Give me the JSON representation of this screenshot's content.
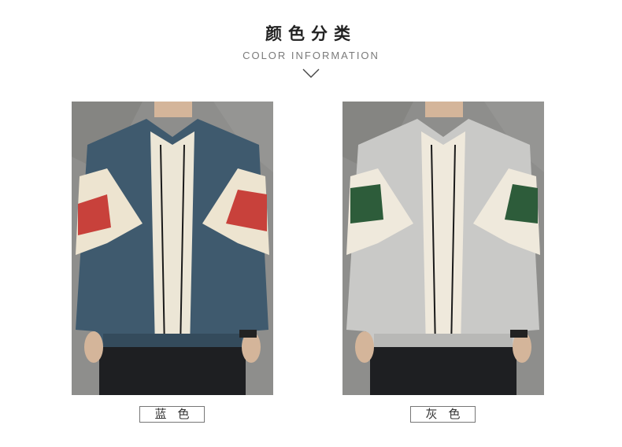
{
  "header": {
    "title": "颜色分类",
    "subtitle": "COLOR INFORMATION"
  },
  "products": [
    {
      "label": "蓝色",
      "jacket_color": "#3f5a6e",
      "stripe_color": "#c8413b",
      "panel_color": "#ede4d0"
    },
    {
      "label": "灰色",
      "jacket_color": "#c9c9c7",
      "stripe_color": "#2d5c3a",
      "panel_color": "#efe9dc"
    }
  ],
  "icons": {
    "chevron": "chevron-down-icon"
  }
}
